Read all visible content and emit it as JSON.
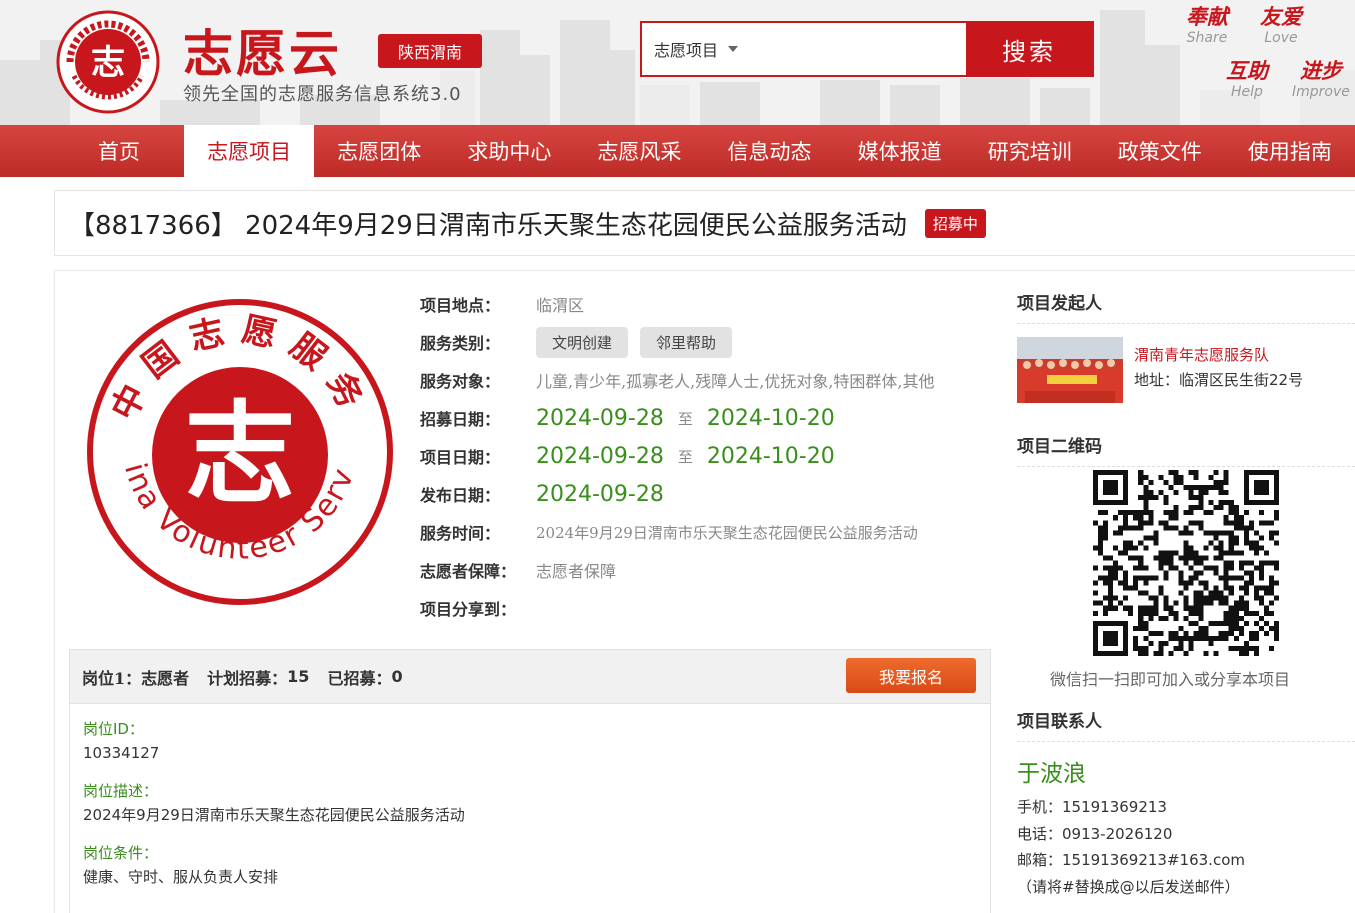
{
  "header": {
    "brand_title": "志愿云",
    "region_label": "陕西渭南",
    "brand_subtitle": "领先全国的志愿服务信息系统3.0",
    "search": {
      "selected_option": "志愿项目",
      "query": "",
      "button_label": "搜索"
    },
    "slogans": [
      {
        "cn": "奉献",
        "en": "Share"
      },
      {
        "cn": "友爱",
        "en": "Love"
      },
      {
        "cn": "互助",
        "en": "Help"
      },
      {
        "cn": "进步",
        "en": "Improve"
      }
    ]
  },
  "nav": {
    "items": [
      "首页",
      "志愿项目",
      "志愿团体",
      "求助中心",
      "志愿风采",
      "信息动态",
      "媒体报道",
      "研究培训",
      "政策文件",
      "使用指南"
    ],
    "active_index": 1
  },
  "project": {
    "title": "【8817366】 2024年9月29日渭南市乐天聚生态花园便民公益服务活动",
    "status": "招募中",
    "labels": {
      "location": "项目地点：",
      "category": "服务类别：",
      "target": "服务对象：",
      "recruit_date": "招募日期：",
      "project_date": "项目日期：",
      "publish_date": "发布日期：",
      "service_time": "服务时间：",
      "guarantee": "志愿者保障：",
      "share": "项目分享到："
    },
    "location": "临渭区",
    "categories": [
      "文明创建",
      "邻里帮助"
    ],
    "target": "儿童,青少年,孤寡老人,残障人士,优抚对象,特困群体,其他",
    "recruit_start": "2024-09-28",
    "recruit_end": "2024-10-20",
    "project_start": "2024-09-28",
    "project_end": "2024-10-20",
    "date_sep": "至",
    "publish_date": "2024-09-28",
    "service_time": "2024年9月29日渭南市乐天聚生态花园便民公益服务活动",
    "guarantee": "志愿者保障",
    "logo_text": {
      "cn_arc": "中国志愿服务",
      "en_arc": "China Volunteer Service",
      "mark": "志"
    }
  },
  "position": {
    "label": "岗位1：",
    "role": "志愿者",
    "plan_label": "计划招募：",
    "plan_count": "15",
    "joined_label": "已招募：",
    "joined_count": "0",
    "signup_label": "我要报名",
    "fields": [
      {
        "label": "岗位ID：",
        "value": "10334127"
      },
      {
        "label": "岗位描述：",
        "value": "2024年9月29日渭南市乐天聚生态花园便民公益服务活动"
      },
      {
        "label": "岗位条件：",
        "value": "健康、守时、服从负责人安排"
      }
    ]
  },
  "sidebar": {
    "initiator_title": "项目发起人",
    "org_name": "渭南青年志愿服务队",
    "org_address": "地址：临渭区民生街22号",
    "qr_title": "项目二维码",
    "qr_caption": "微信扫一扫即可加入或分享本项目",
    "contact_title": "项目联系人",
    "contact_name": "于波浪",
    "mobile": "手机：15191369213",
    "phone": "电话：0913-2026120",
    "email": "邮箱：15191369213#163.com",
    "email_note": "（请将#替换成@以后发送邮件）"
  },
  "colors": {
    "brand_red": "#c8161d",
    "date_green": "#3a8e1c",
    "signup_orange": "#e05a1f"
  }
}
